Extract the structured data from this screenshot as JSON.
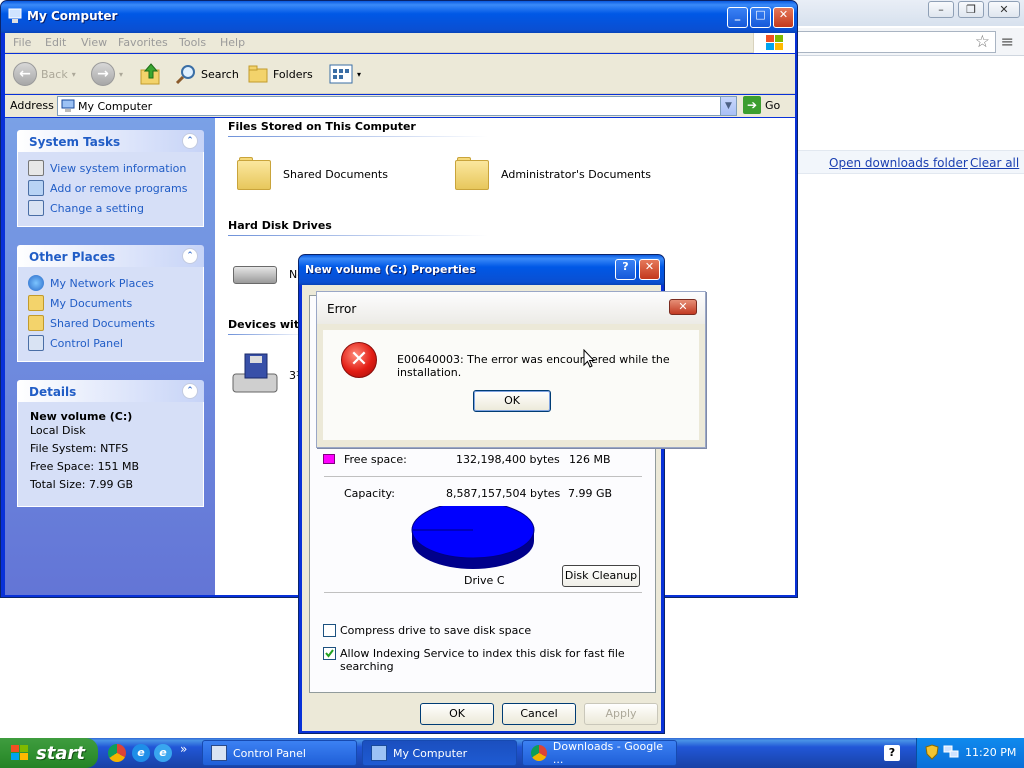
{
  "chrome": {
    "downloads": {
      "open_folder": "Open downloads folder",
      "clear_all": "Clear all"
    }
  },
  "explorer": {
    "title": "My Computer",
    "menu": [
      "File",
      "Edit",
      "View",
      "Favorites",
      "Tools",
      "Help"
    ],
    "toolbar": {
      "back": "Back",
      "search": "Search",
      "folders": "Folders"
    },
    "address": {
      "label": "Address",
      "value": "My Computer",
      "go": "Go"
    },
    "system_tasks": {
      "title": "System Tasks",
      "items": [
        "View system information",
        "Add or remove programs",
        "Change a setting"
      ]
    },
    "other_places": {
      "title": "Other Places",
      "items": [
        "My Network Places",
        "My Documents",
        "Shared Documents",
        "Control Panel"
      ]
    },
    "details": {
      "title": "Details",
      "name": "New volume (C:)",
      "type": "Local Disk",
      "fs": "File System: NTFS",
      "free": "Free Space: 151 MB",
      "total": "Total Size: 7.99 GB"
    },
    "content": {
      "files_header": "Files Stored on This Computer",
      "files": [
        "Shared Documents",
        "Administrator's Documents"
      ],
      "hdd_header": "Hard Disk Drives",
      "hdd_item": "New",
      "removable_header": "Devices with",
      "removable_item": "3½"
    }
  },
  "properties": {
    "title": "New volume (C:) Properties",
    "free_label": "Free space:",
    "free_bytes": "132,198,400 bytes",
    "free_size": "126 MB",
    "capacity_label": "Capacity:",
    "capacity_bytes": "8,587,157,504 bytes",
    "capacity_size": "7.99 GB",
    "drive_label": "Drive C",
    "disk_cleanup": "Disk Cleanup",
    "compress": "Compress drive to save disk space",
    "compress_checked": false,
    "indexing": "Allow Indexing Service to index this disk for fast file searching",
    "indexing_checked": true,
    "ok": "OK",
    "cancel": "Cancel",
    "apply": "Apply",
    "used_color": "#0000ff",
    "free_color": "#ff00ff"
  },
  "error": {
    "title": "Error",
    "message": "E00640003: The error was encountered while the installation.",
    "ok": "OK"
  },
  "taskbar": {
    "start": "start",
    "tasks": [
      "Control Panel",
      "My Computer",
      "Downloads - Google ..."
    ],
    "clock": "11:20 PM"
  }
}
